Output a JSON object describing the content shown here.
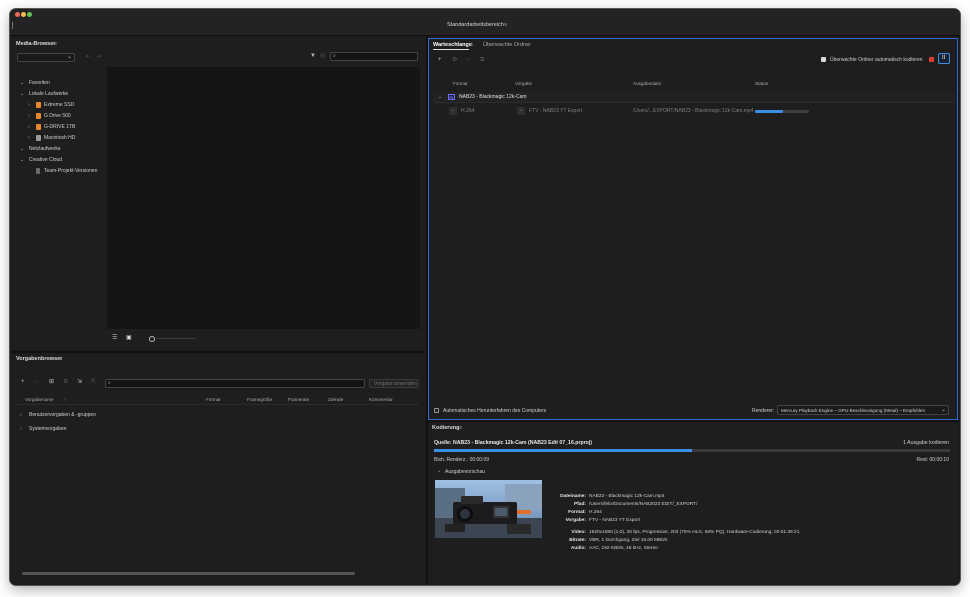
{
  "workspace": {
    "title": "Standardarbeitsbereich",
    "menu": "≡"
  },
  "media_browser": {
    "title": "Media-Browser",
    "menu": "≡",
    "search_placeholder": "",
    "tree": {
      "favorites": "Favoriten",
      "local_drives": "Lokale Laufwerke",
      "drives": [
        {
          "label": "Extreme SSD",
          "color": "#e8892b"
        },
        {
          "label": "G Drive 500",
          "color": "#e8892b"
        },
        {
          "label": "G-DRIVE 1TB",
          "color": "#e8892b"
        },
        {
          "label": "Macintosh HD",
          "color": "#9a9a9a"
        }
      ],
      "network_drives": "Netzlaufwerke",
      "creative_cloud": "Creative Cloud",
      "team_projects": "Team-Projekt-Versionen"
    }
  },
  "preset_browser": {
    "title": "Vorgabenbrowser",
    "menu": "≡",
    "search_placeholder": "",
    "apply_button": "Vorgabe anwenden",
    "columns": {
      "name": "Vorgabename",
      "sort_icon": "↑",
      "format": "Format",
      "frame_size": "Framegröße",
      "frame_rate": "Framerate",
      "target_rate": "Zielrate",
      "comment": "Kommentar"
    },
    "groups": [
      "Benutzervorgaben & -gruppen",
      "Systemvorgaben"
    ]
  },
  "queue": {
    "tabs": [
      "Warteschlange",
      "Überwachte Ordner"
    ],
    "tab_menu": "≡",
    "auto_encode_label": "Überwachte Ordner automatisch kodieren",
    "columns": {
      "format": "Format",
      "preset": "Vorgabe",
      "output": "Ausgabedatei",
      "status": "Status"
    },
    "source": {
      "badge": "Pr",
      "name": "NAB23 - Blackmagic 12k-Cam"
    },
    "job": {
      "format": "H.264",
      "preset": "FTV - NAB23 YT Export",
      "output": "/Users/...EXPORT/NAB23 - Blackmagic 12k-Cam.mp4",
      "progress": 0.52
    },
    "shutdown_label": "Automatisches Herunterfahren des Computers",
    "renderer_label": "Renderer:",
    "renderer_value": "Mercury Playback Engine – GPU-Beschleunigung (Metal) – Empfohlen"
  },
  "encoding": {
    "title": "Kodierung",
    "menu": "≡",
    "source_line": "Quelle: NAB23 - Blackmagic 12k-Cam (NAB23 Edit 07_16.prproj)",
    "outputs": "1 Ausgabe kodieren",
    "progress": 0.5,
    "elapsed": "Bish. Renderz.: 00:00:09",
    "remaining": "Rest: 00:00:10",
    "preview_label": "Ausgabevorschau",
    "details": {
      "filename_label": "Dateiname:",
      "filename": "NAB23 - Blackmagic 12k-Cam.mp4",
      "path_label": "Pfad:",
      "path": "/Users/felix/Documents/NAB2023 EDIT/_EXPORT/",
      "format_label": "Format:",
      "format": "H.264",
      "preset_label": "Vorgabe:",
      "preset": "FTV - NAB23 YT Export",
      "video_label": "Video:",
      "video": "1920x1080 (1,0), 25 fps, Progressive, 203 (75% HLG, 58% PQ), Hardware-Codierung, 00:01:39:21",
      "bitrate_label": "Bitrate:",
      "bitrate": "VBR, 1 Durchgang, Ziel 15.00 MBit/s",
      "audio_label": "Audio:",
      "audio": "AAC, 192 KBit/s, 48 kHz, Stereo"
    }
  },
  "colors": {
    "accent_blue": "#3a8ee6",
    "record_red": "#e33a32",
    "active_border": "#2f6cd8"
  }
}
